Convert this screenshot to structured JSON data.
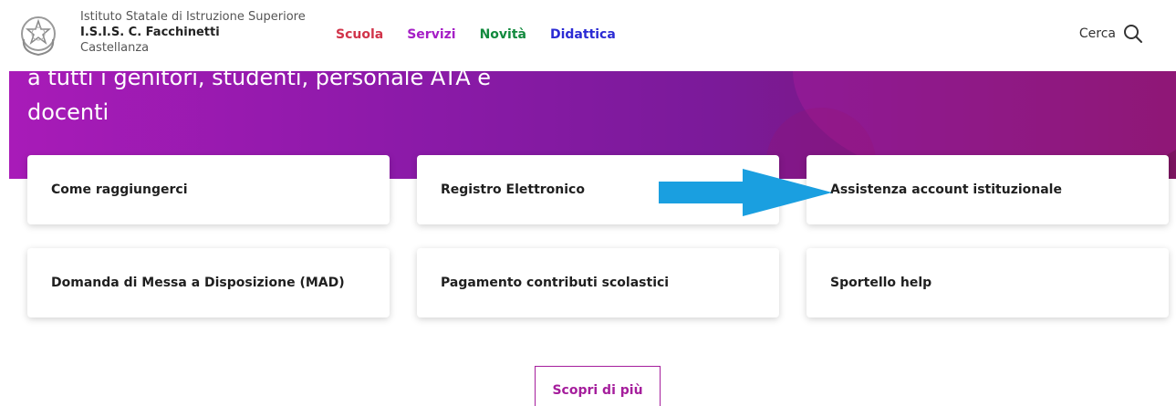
{
  "header": {
    "school_line1": "Istituto Statale di Istruzione Superiore",
    "school_line2": "I.S.I.S. C. Facchinetti",
    "school_line3": "Castellanza",
    "logo_icon": "republic-emblem-icon",
    "nav": [
      {
        "label": "Scuola",
        "color": "#d1344a"
      },
      {
        "label": "Servizi",
        "color": "#a51ec6"
      },
      {
        "label": "Novità",
        "color": "#128a3e"
      },
      {
        "label": "Didattica",
        "color": "#2b2bd4"
      }
    ],
    "search_label": "Cerca",
    "search_icon": "search-icon"
  },
  "hero": {
    "text_line1": "a tutti i genitori, studenti, personale ATA e",
    "text_line2": "docenti",
    "colors": {
      "start": "#a81bb8",
      "end": "#7c1560"
    }
  },
  "cards": [
    {
      "label": "Come raggiungerci"
    },
    {
      "label": "Registro Elettronico"
    },
    {
      "label": "Assistenza account istituzionale"
    },
    {
      "label": "Domanda di Messa a Disposizione (MAD)"
    },
    {
      "label": "Pagamento contributi scolastici"
    },
    {
      "label": "Sportello help"
    }
  ],
  "annotation": {
    "icon": "arrow-right-icon",
    "color": "#1a9fe0"
  },
  "more_button": {
    "label": "Scopri di più",
    "color": "#a51e9c"
  }
}
